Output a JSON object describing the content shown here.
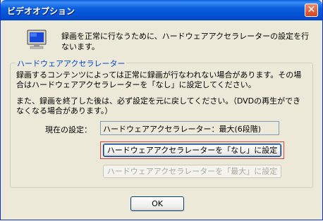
{
  "window": {
    "title": "ビデオオプション",
    "close_label": "✕"
  },
  "header": {
    "message": "録画を正常に行なうために、ハードウェアアクセラレーターの設定を行ないます。"
  },
  "group": {
    "legend": "ハードウェアアクセラレーター",
    "paragraph1": "録画するコンテンツによっては正常に録画が行なわれない場合があります。その場合はハードウェアアクセラレーターを「なし」に設定してください。",
    "paragraph2": "また、録画を終了した後は、必ず設定を元に戻してください。（DVDの再生ができなくなる場合があります。）",
    "current_label": "現在の設定：",
    "current_value": "ハードウェアアクセラレーター：最大(6段階)",
    "set_none_label": "ハードウェアアクセラレーターを「なし」に設定",
    "set_max_label": "ハードウェアアクセラレーターを「最大」に設定"
  },
  "footer": {
    "ok_label": "OK"
  },
  "colors": {
    "titlebar": "#0653d6",
    "legend": "#0046d5",
    "highlight": "#e04343",
    "face": "#ece9d8"
  }
}
